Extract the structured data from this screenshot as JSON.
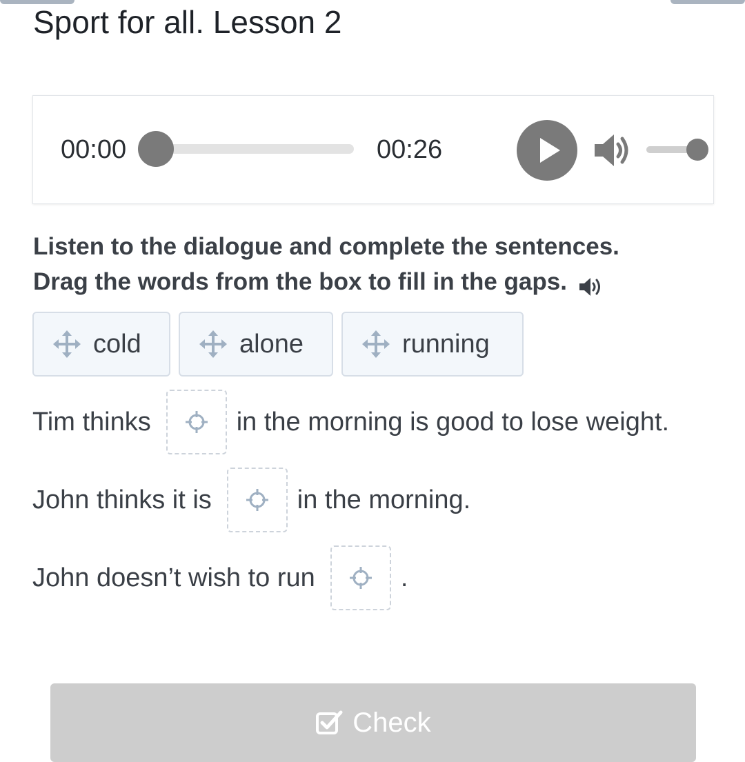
{
  "page": {
    "title": "Sport for all. Lesson 2"
  },
  "audio_player": {
    "current_time": "00:00",
    "total_time": "00:26",
    "progress_fraction": 0,
    "volume_fraction": 1,
    "play_icon": "play-icon",
    "volume_icon": "volume-icon"
  },
  "instruction": {
    "line1": "Listen to the dialogue and complete the sentences.",
    "line2": "Drag the words from the box to fill in the gaps.",
    "speaker_icon": "speaker-icon"
  },
  "word_bank": [
    {
      "label": "cold",
      "icon": "move-icon"
    },
    {
      "label": "alone",
      "icon": "move-icon"
    },
    {
      "label": "running",
      "icon": "move-icon"
    }
  ],
  "sentences": [
    {
      "before": "Tim thinks",
      "after": "in the morning is good to lose weight."
    },
    {
      "before": "John thinks it is",
      "after": "in the morning."
    },
    {
      "before": "John doesn’t wish to run",
      "after": "."
    }
  ],
  "gap_icon": "crosshair-icon",
  "check_button": {
    "label": "Check",
    "icon": "checkbox-check-icon"
  },
  "colors": {
    "accent_grey": "#7a7a7a",
    "chip_background": "#f3f7fb",
    "chip_border": "#d7dee7",
    "button_disabled": "#cdcdcd",
    "icon_blue_grey": "#9fb0c2"
  }
}
